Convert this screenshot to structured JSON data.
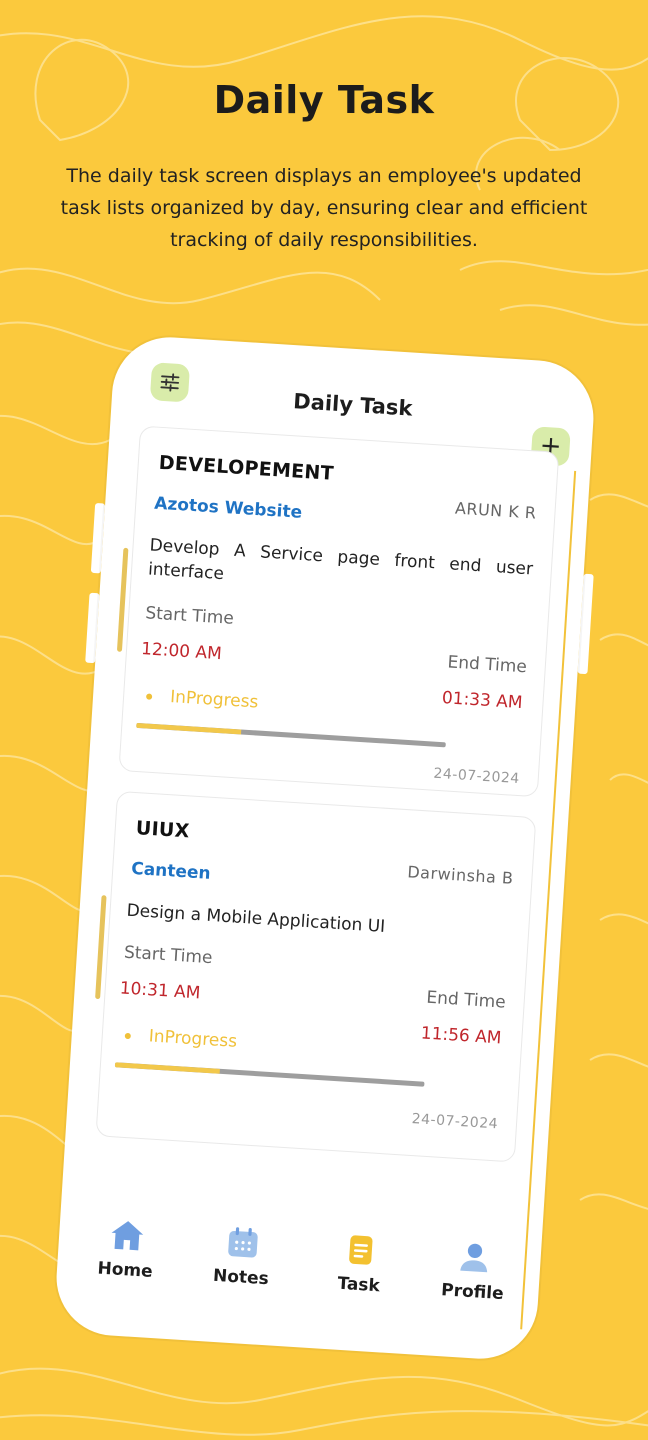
{
  "promo": {
    "title": "Daily Task",
    "subtitle": "The daily task screen displays an employee's updated task lists organized by day, ensuring clear and efficient tracking of daily responsibilities."
  },
  "app": {
    "title": "Daily Task",
    "add_label": "+"
  },
  "tasks": [
    {
      "category": "DEVELOPEMENT",
      "project": "Azotos Website",
      "assignee": "ARUN K R",
      "description": "Develop A Service page front end user interface",
      "start_label": "Start Time",
      "start_time": "12:00 AM",
      "end_label": "End Time",
      "end_time": "01:33 AM",
      "status": "InProgress",
      "progress": 0.34,
      "date": "24-07-2024"
    },
    {
      "category": "UIUX",
      "project": "Canteen",
      "assignee": "Darwinsha B",
      "description": "Design a Mobile Application UI",
      "start_label": "Start Time",
      "start_time": "10:31 AM",
      "end_label": "End Time",
      "end_time": "11:56 AM",
      "status": "InProgress",
      "progress": 0.34,
      "date": "24-07-2024"
    }
  ],
  "nav": {
    "items": [
      {
        "label": "Home",
        "icon": "home-icon",
        "color": "#6f9ee0"
      },
      {
        "label": "Notes",
        "icon": "calendar-icon",
        "color": "#9fc1ea"
      },
      {
        "label": "Task",
        "icon": "task-icon",
        "color": "#f3c130"
      },
      {
        "label": "Profile",
        "icon": "profile-icon",
        "color": "#6f9ee0"
      }
    ]
  },
  "colors": {
    "background": "#fbc93d",
    "accent": "#f0c13a",
    "project_link": "#1f73c4",
    "time": "#c0262c",
    "button_bg": "#d9ecaa"
  }
}
